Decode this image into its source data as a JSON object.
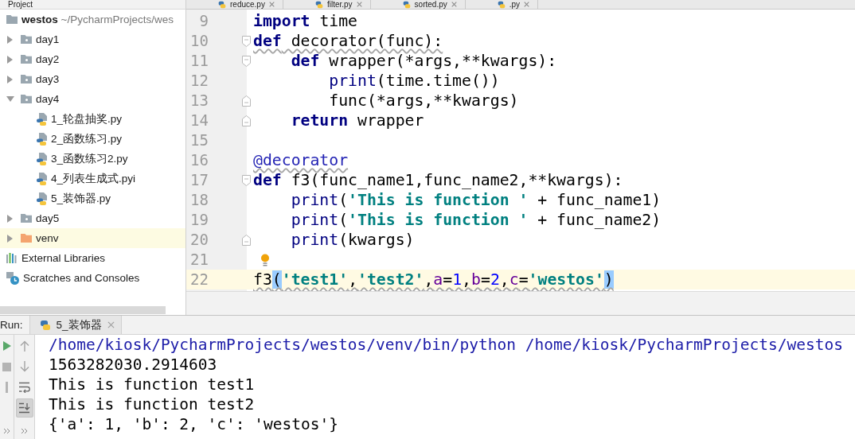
{
  "project_panel": {
    "title": "Project",
    "tree": [
      {
        "kind": "project",
        "name": "westos",
        "path": "~/PycharmProjects/wes",
        "highlighted": false,
        "children": [
          {
            "kind": "package",
            "name": "day1",
            "expanded": false,
            "highlighted": false
          },
          {
            "kind": "package",
            "name": "day2",
            "expanded": false,
            "highlighted": false
          },
          {
            "kind": "package",
            "name": "day3",
            "expanded": false,
            "highlighted": false
          },
          {
            "kind": "package",
            "name": "day4",
            "expanded": true,
            "highlighted": false,
            "children": [
              {
                "kind": "python",
                "name": "1_轮盘抽奖.py",
                "highlighted": false
              },
              {
                "kind": "python",
                "name": "2_函数练习.py",
                "highlighted": false
              },
              {
                "kind": "python",
                "name": "3_函数练习2.py",
                "highlighted": false
              },
              {
                "kind": "python",
                "name": "4_列表生成式.pyi",
                "highlighted": false
              },
              {
                "kind": "python",
                "name": "5_装饰器.py",
                "highlighted": false
              }
            ]
          },
          {
            "kind": "package",
            "name": "day5",
            "expanded": false,
            "highlighted": false
          },
          {
            "kind": "excluded",
            "name": "venv",
            "expanded": false,
            "highlighted": true
          }
        ]
      },
      {
        "kind": "libraries",
        "name": "External Libraries",
        "highlighted": false
      },
      {
        "kind": "scratches",
        "name": "Scratches and Consoles",
        "highlighted": false
      }
    ]
  },
  "editor": {
    "tabs": [
      {
        "label": "reduce.py"
      },
      {
        "label": "filter.py"
      },
      {
        "label": "sorted.py"
      },
      {
        "label": ".py"
      }
    ],
    "lines": [
      {
        "number": "9",
        "fold_start": false,
        "fold_end": false,
        "current": false,
        "warning": false,
        "bulb": false,
        "tokens": [
          {
            "kind": "keyword",
            "text": "import"
          },
          {
            "kind": "plain",
            "text": " time"
          }
        ]
      },
      {
        "number": "10",
        "fold_start": true,
        "fold_end": false,
        "current": false,
        "warning": true,
        "bulb": false,
        "tokens": [
          {
            "kind": "keyword",
            "text": "def"
          },
          {
            "kind": "plain",
            "text": " decorator(func):"
          }
        ]
      },
      {
        "number": "11",
        "fold_start": true,
        "fold_end": false,
        "current": false,
        "warning": false,
        "bulb": false,
        "tokens": [
          {
            "kind": "keyword",
            "text": "    def"
          },
          {
            "kind": "plain",
            "text": " wrapper(*args,**kwargs):"
          }
        ]
      },
      {
        "number": "12",
        "fold_start": false,
        "fold_end": false,
        "current": false,
        "warning": false,
        "bulb": false,
        "tokens": [
          {
            "kind": "builtin",
            "text": "        print"
          },
          {
            "kind": "plain",
            "text": "(time.time())"
          }
        ]
      },
      {
        "number": "13",
        "fold_start": false,
        "fold_end": true,
        "current": false,
        "warning": false,
        "bulb": false,
        "tokens": [
          {
            "kind": "plain",
            "text": "        func(*args,**kwargs)"
          }
        ]
      },
      {
        "number": "14",
        "fold_start": false,
        "fold_end": true,
        "current": false,
        "warning": false,
        "bulb": false,
        "tokens": [
          {
            "kind": "keyword",
            "text": "    return"
          },
          {
            "kind": "plain",
            "text": " wrapper"
          }
        ]
      },
      {
        "number": "15",
        "fold_start": false,
        "fold_end": false,
        "current": false,
        "bulb": false
      },
      {
        "number": "16",
        "fold_start": false,
        "fold_end": false,
        "current": false,
        "warning": true,
        "bulb": false,
        "tokens": [
          {
            "kind": "decorator",
            "text": "@decorator"
          }
        ]
      },
      {
        "number": "17",
        "fold_start": true,
        "fold_end": false,
        "current": false,
        "warning": false,
        "bulb": false,
        "tokens": [
          {
            "kind": "keyword",
            "text": "def"
          },
          {
            "kind": "plain",
            "text": " f3(func_name1,func_name2,**kwargs):"
          }
        ]
      },
      {
        "number": "18",
        "fold_start": false,
        "fold_end": false,
        "current": false,
        "warning": false,
        "bulb": false,
        "tokens": [
          {
            "kind": "builtin",
            "text": "    print"
          },
          {
            "kind": "plain",
            "text": "("
          },
          {
            "kind": "string",
            "text": "'This is function '"
          },
          {
            "kind": "plain",
            "text": " + func_name1)"
          }
        ]
      },
      {
        "number": "19",
        "fold_start": false,
        "fold_end": false,
        "current": false,
        "warning": false,
        "bulb": false,
        "tokens": [
          {
            "kind": "builtin",
            "text": "    print"
          },
          {
            "kind": "plain",
            "text": "("
          },
          {
            "kind": "string",
            "text": "'This is function '"
          },
          {
            "kind": "plain",
            "text": " + func_name2)"
          }
        ]
      },
      {
        "number": "20",
        "fold_start": false,
        "fold_end": true,
        "current": false,
        "warning": false,
        "bulb": false,
        "tokens": [
          {
            "kind": "builtin",
            "text": "    print"
          },
          {
            "kind": "plain",
            "text": "(kwargs)"
          }
        ]
      },
      {
        "number": "21",
        "fold_start": false,
        "fold_end": false,
        "current": false,
        "bulb": true
      },
      {
        "number": "22",
        "fold_start": false,
        "fold_end": false,
        "current": true,
        "warning": true,
        "bulb": false,
        "tokens": [
          {
            "kind": "plain",
            "text": "f3"
          },
          {
            "kind": "bracket_match",
            "text": "("
          },
          {
            "kind": "string",
            "text": "'test1'"
          },
          {
            "kind": "plain",
            "text": ","
          },
          {
            "kind": "string",
            "text": "'test2'"
          },
          {
            "kind": "plain",
            "text": ","
          },
          {
            "kind": "param",
            "text": "a"
          },
          {
            "kind": "plain",
            "text": "="
          },
          {
            "kind": "number",
            "text": "1"
          },
          {
            "kind": "plain",
            "text": ","
          },
          {
            "kind": "param",
            "text": "b"
          },
          {
            "kind": "plain",
            "text": "="
          },
          {
            "kind": "number",
            "text": "2"
          },
          {
            "kind": "plain",
            "text": ","
          },
          {
            "kind": "param",
            "text": "c"
          },
          {
            "kind": "plain",
            "text": "="
          },
          {
            "kind": "string",
            "text": "'westos'"
          },
          {
            "kind": "bracket_match",
            "text": ")"
          }
        ]
      }
    ]
  },
  "run": {
    "label": "Run:",
    "tab": {
      "label": "5_装饰器"
    },
    "left_toolbar": [
      {
        "kind": "rerun",
        "disabled": false
      },
      {
        "kind": "stop",
        "disabled": true
      },
      {
        "kind": "pause",
        "disabled": true
      },
      {
        "kind": "more",
        "disabled": false
      }
    ],
    "side_toolbar": [
      {
        "kind": "up",
        "on": false
      },
      {
        "kind": "down",
        "on": false
      },
      {
        "kind": "soft_wrap",
        "on": false
      },
      {
        "kind": "scroll_to_end",
        "on": true
      },
      {
        "kind": "more",
        "on": false
      }
    ],
    "output": [
      {
        "kind": "command",
        "text": "/home/kiosk/PycharmProjects/westos/venv/bin/python /home/kiosk/PycharmProjects/westos"
      },
      {
        "kind": "stdout",
        "text": "1563282030.2914603"
      },
      {
        "kind": "stdout",
        "text": "This is function test1"
      },
      {
        "kind": "stdout",
        "text": "This is function test2"
      },
      {
        "kind": "stdout",
        "text": "{'a': 1, 'b': 2, 'c': 'westos'}"
      }
    ]
  }
}
